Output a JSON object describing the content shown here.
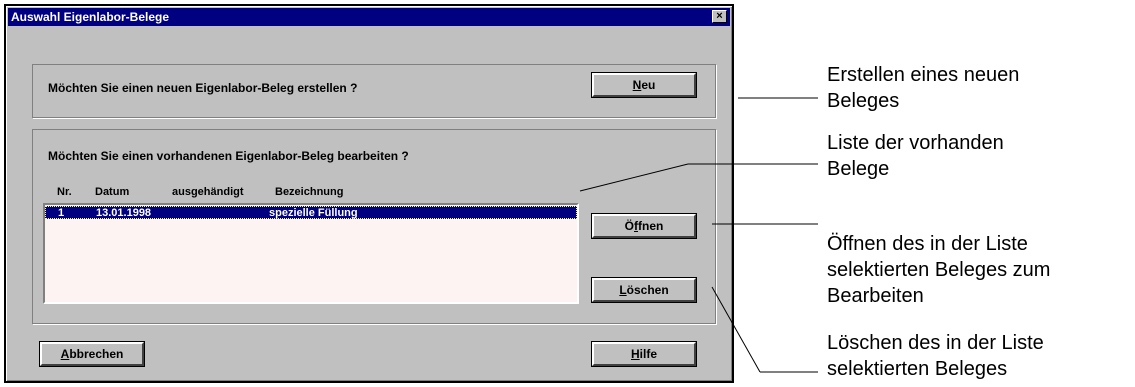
{
  "dialog": {
    "title": "Auswahl Eigenlabor-Belege",
    "close_symbol": "×"
  },
  "new_section": {
    "question": "Möchten Sie einen neuen Eigenlabor-Beleg erstellen ?",
    "new_button": {
      "mnemonic": "N",
      "rest": "eu"
    }
  },
  "edit_section": {
    "question": "Möchten Sie einen vorhandenen Eigenlabor-Beleg bearbeiten ?",
    "columns": [
      "Nr.",
      "Datum",
      "ausgehändigt",
      "Bezeichnung"
    ],
    "rows": [
      {
        "nr": "1",
        "datum": "13.01.1998",
        "ausgehaendigt": "",
        "bezeichnung": "spezielle Füllung",
        "selected": true
      }
    ],
    "open_button": {
      "pre": "Ö",
      "mnemonic": "f",
      "rest": "fnen"
    },
    "delete_button": {
      "mnemonic": "L",
      "rest": "öschen"
    }
  },
  "footer": {
    "cancel_button": {
      "mnemonic": "A",
      "rest": "bbrechen"
    },
    "help_button": {
      "mnemonic": "H",
      "rest": "ilfe"
    }
  },
  "annotations": {
    "new": [
      "Erstellen eines neuen",
      "Beleges"
    ],
    "list": [
      "Liste der vorhanden",
      "Belege"
    ],
    "open": [
      "Öffnen des in der Liste",
      "selektierten Beleges zum",
      "Bearbeiten"
    ],
    "delete": [
      "Löschen des in der Liste",
      "selektierten Beleges"
    ]
  }
}
